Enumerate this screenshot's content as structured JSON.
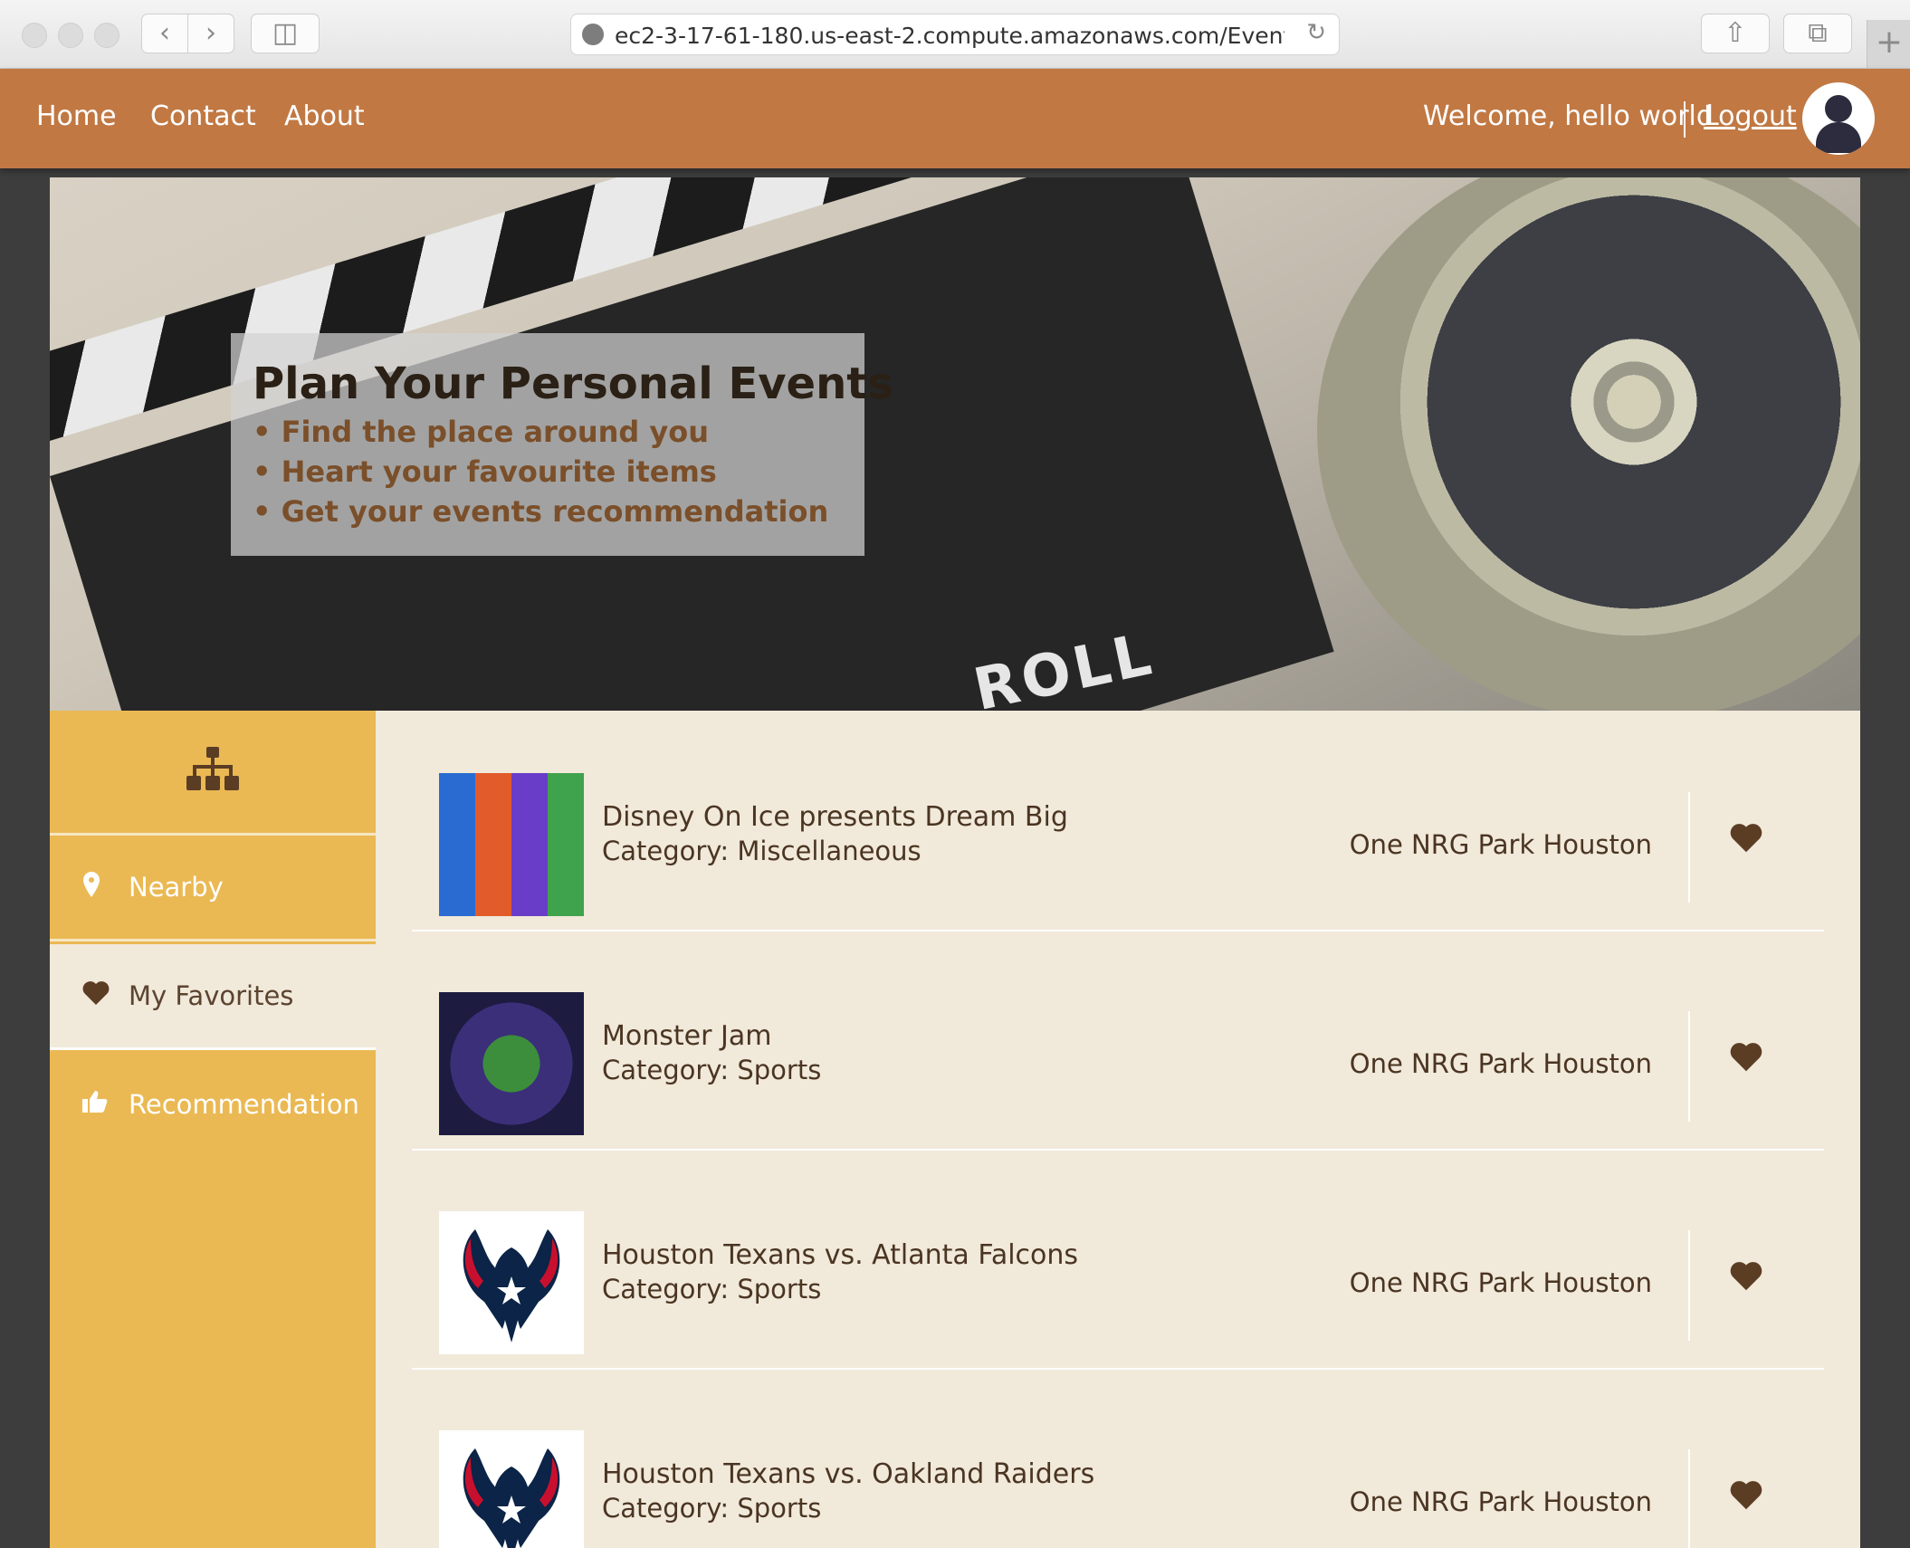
{
  "browser": {
    "url": "ec2-3-17-61-180.us-east-2.compute.amazonaws.com/EventRecommend/"
  },
  "nav": {
    "links": [
      "Home",
      "Contact",
      "About"
    ],
    "welcome": "Welcome, hello world",
    "logout": "Logout"
  },
  "hero": {
    "title": "Plan Your Personal Events",
    "bullets": [
      "• Find the place around you",
      "• Heart your favourite items",
      "• Get your events recommendation"
    ],
    "image_text": "ROLL"
  },
  "sidebar": {
    "items": [
      {
        "label": "Nearby",
        "icon": "map-pin-icon"
      },
      {
        "label": "My Favorites",
        "icon": "heart-icon"
      },
      {
        "label": "Recommendation",
        "icon": "thumbs-up-icon"
      }
    ]
  },
  "events": [
    {
      "title": "Disney On Ice presents Dream Big",
      "category": "Category: Miscellaneous",
      "address": "One NRG Park Houston"
    },
    {
      "title": "Monster Jam",
      "category": "Category: Sports",
      "address": "One NRG Park Houston"
    },
    {
      "title": "Houston Texans vs. Atlanta Falcons",
      "category": "Category: Sports",
      "address": "One NRG Park Houston"
    },
    {
      "title": "Houston Texans vs. Oakland Raiders",
      "category": "Category: Sports",
      "address": "One NRG Park Houston"
    }
  ],
  "colors": {
    "nav": "#c17843",
    "sidebar": "#eab954",
    "content_bg": "#f1e9da",
    "text_brown": "#4a3522"
  }
}
